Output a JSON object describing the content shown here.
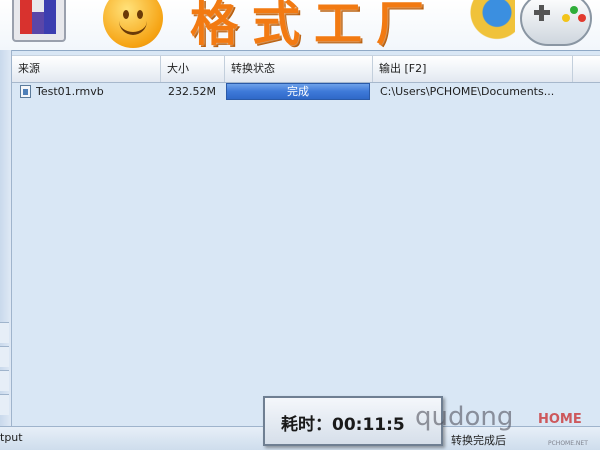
{
  "banner": {
    "title": "格式工厂",
    "icons": [
      "blocks-icon",
      "smiley-icon",
      "horn-globe-icon",
      "gamepad-icon"
    ]
  },
  "file_list": {
    "columns": [
      "来源",
      "大小",
      "转换状态",
      "输出 [F2]"
    ],
    "rows": [
      {
        "source": "Test01.rmvb",
        "size": "232.52M",
        "status": "完成",
        "status_progress": 1.0,
        "output": "C:\\Users\\PCHOME\\Documents..."
      }
    ]
  },
  "status_bar": {
    "output_label": "tput",
    "after_convert_label": "转换完成后"
  },
  "elapsed": {
    "text": "耗时：00:11:5"
  },
  "watermark": {
    "text": "qudong",
    "badge": "HOME",
    "small": "PCHOME.NET"
  },
  "colors": {
    "banner_title": "#f27a12",
    "progress_fill": "#3e79d8",
    "list_background": "#d9e7f5"
  }
}
